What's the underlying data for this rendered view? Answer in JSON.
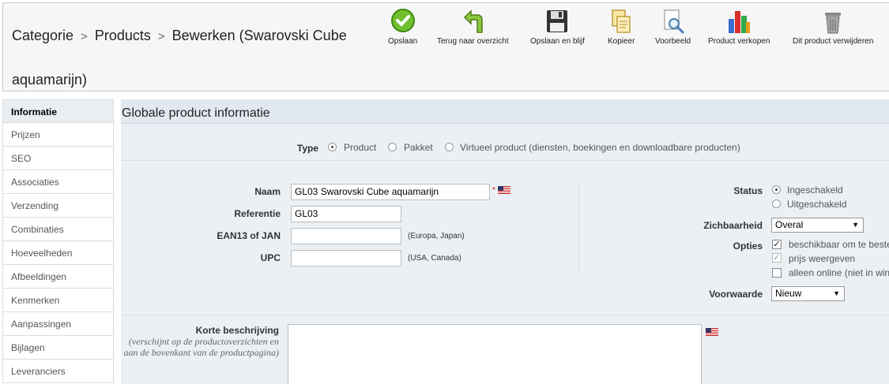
{
  "breadcrumb": {
    "items": [
      "Categorie",
      "Products",
      "Bewerken (Swarovski Cube aquamarijn)"
    ],
    "separator": ">"
  },
  "toolbar": {
    "save": "Opslaan",
    "back": "Terug naar overzicht",
    "save_stay": "Opslaan en blijf",
    "copy": "Kopieer",
    "preview": "Voorbeeld",
    "sales": "Product verkopen",
    "delete": "Dit product verwijderen"
  },
  "sidebar": {
    "items": [
      "Informatie",
      "Prijzen",
      "SEO",
      "Associaties",
      "Verzending",
      "Combinaties",
      "Hoeveelheden",
      "Afbeeldingen",
      "Kenmerken",
      "Aanpassingen",
      "Bijlagen",
      "Leveranciers"
    ],
    "active": "Informatie"
  },
  "main": {
    "title": "Globale product informatie",
    "type": {
      "label": "Type",
      "options": [
        "Product",
        "Pakket",
        "Virtueel product (diensten, boekingen en downloadbare producten)"
      ],
      "selected": "Product"
    },
    "naam": {
      "label": "Naam",
      "value": "GL03 Swarovski Cube aquamarijn",
      "required": "*"
    },
    "referentie": {
      "label": "Referentie",
      "value": "GL03"
    },
    "ean13": {
      "label": "EAN13 of JAN",
      "value": "",
      "hint": "(Europa, Japan)"
    },
    "upc": {
      "label": "UPC",
      "value": "",
      "hint": "(USA, Canada)"
    },
    "status": {
      "label": "Status",
      "options": [
        "Ingeschakeld",
        "Uitgeschakeld"
      ],
      "selected": "Ingeschakeld"
    },
    "zichtbaarheid": {
      "label": "Zichbaarheid",
      "value": "Overal"
    },
    "opties": {
      "label": "Opties",
      "items": [
        {
          "label": "beschikbaar om te bestellen",
          "checked": true
        },
        {
          "label": "prijs weergeven",
          "checked": true
        },
        {
          "label": "alleen online (niet in winkel)",
          "checked": false
        }
      ]
    },
    "voorwaarde": {
      "label": "Voorwaarde",
      "value": "Nieuw"
    },
    "korte_beschrijving": {
      "label": "Korte beschrijving",
      "hint": "(verschijnt op de productoverzichten en aan de bovenkant van de productpagina)"
    }
  },
  "icons": {
    "save": "check-circle-icon",
    "back": "undo-arrow-icon",
    "save_stay": "floppy-disk-icon",
    "copy": "copy-pages-icon",
    "preview": "magnifier-page-icon",
    "sales": "bar-chart-icon",
    "delete": "trash-bin-icon",
    "language": "us-flag-icon"
  },
  "colors": {
    "toolbar_bg": "#f6f6f6",
    "panel_bg": "#ebf0f5",
    "active_tab_bg": "#e9eef3"
  }
}
